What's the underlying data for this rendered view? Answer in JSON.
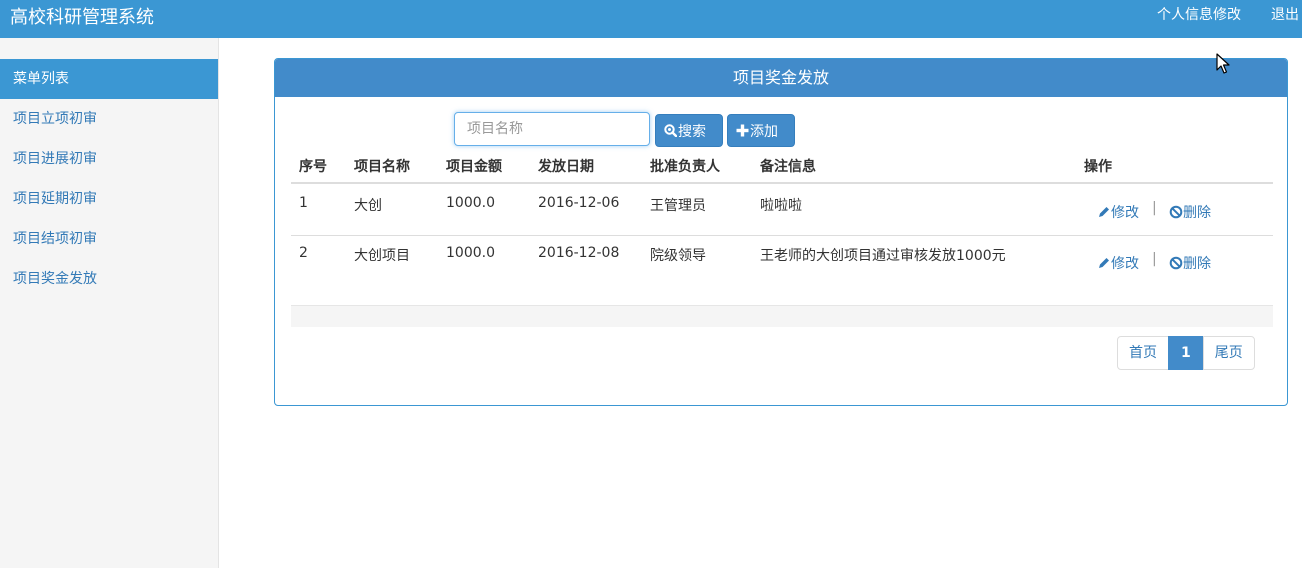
{
  "header": {
    "title": "高校科研管理系统",
    "profile_link": "个人信息修改",
    "logout_link": "退出"
  },
  "sidebar": {
    "header": "菜单列表",
    "items": [
      {
        "label": "项目立项初审"
      },
      {
        "label": "项目进展初审"
      },
      {
        "label": "项目延期初审"
      },
      {
        "label": "项目结项初审"
      },
      {
        "label": "项目奖金发放"
      }
    ]
  },
  "panel": {
    "title": "项目奖金发放",
    "search": {
      "placeholder": "项目名称",
      "value": ""
    },
    "search_button": "搜索",
    "add_button": "添加"
  },
  "table": {
    "headers": [
      "序号",
      "项目名称",
      "项目金额",
      "发放日期",
      "批准负责人",
      "备注信息",
      "操作"
    ],
    "rows": [
      {
        "index": "1",
        "name": "大创",
        "amount": "1000.0",
        "date": "2016-12-06",
        "approver": "王管理员",
        "note": "啦啦啦",
        "edit": "修改",
        "delete": "删除"
      },
      {
        "index": "2",
        "name": "大创项目",
        "amount": "1000.0",
        "date": "2016-12-08",
        "approver": "院级领导",
        "note": "王老师的大创项目通过审核发放1000元",
        "edit": "修改",
        "delete": "删除"
      }
    ],
    "separator": "|"
  },
  "pagination": {
    "first": "首页",
    "current": "1",
    "last": "尾页"
  },
  "icons": {
    "search": "search-icon",
    "add": "plus-icon",
    "edit": "pencil-icon",
    "delete": "ban-icon"
  },
  "colors": {
    "primary": "#3b97d3",
    "panel_heading": "#428bca",
    "link": "#337ab7"
  }
}
